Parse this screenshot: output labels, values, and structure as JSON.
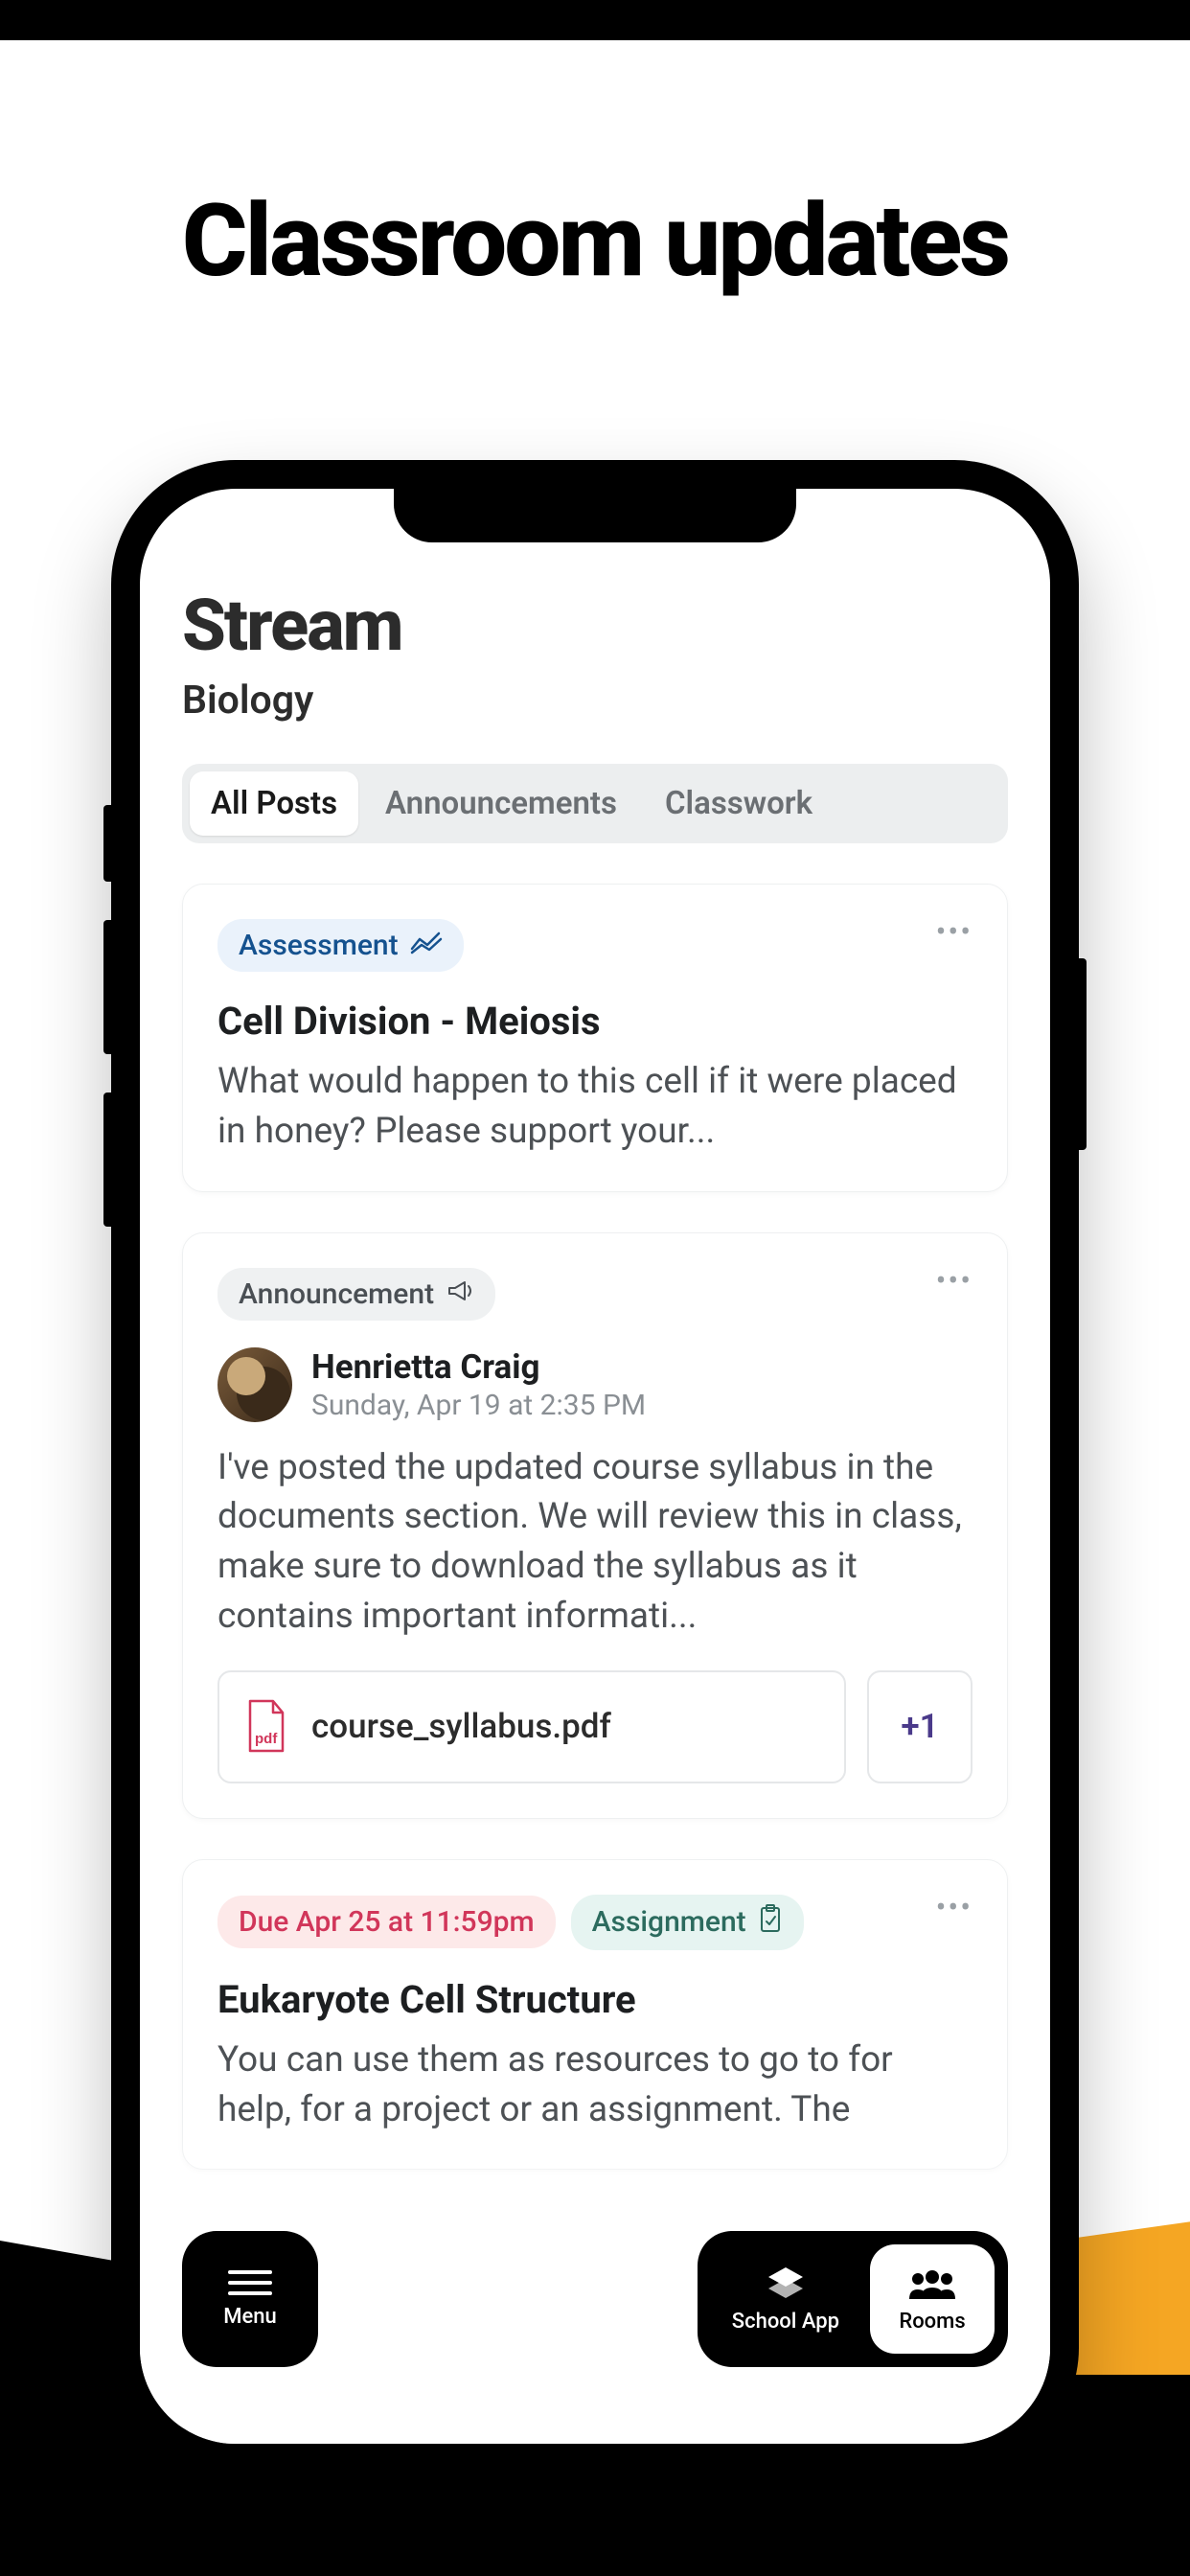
{
  "hero": {
    "title": "Classroom updates"
  },
  "header": {
    "title": "Stream",
    "subtitle": "Biology"
  },
  "tabs": [
    {
      "label": "All Posts",
      "active": true
    },
    {
      "label": "Announcements",
      "active": false
    },
    {
      "label": "Classwork",
      "active": false
    }
  ],
  "posts": [
    {
      "type_label": "Assessment",
      "title": "Cell Division - Meiosis",
      "body": "What would happen to this cell if it were placed in honey? Please support your..."
    },
    {
      "type_label": "Announcement",
      "author": {
        "name": "Henrietta Craig",
        "date": "Sunday, Apr 19 at 2:35 PM"
      },
      "body": "I've posted the updated course syllabus in the documents section. We will review this in class, make sure to download the syllabus as it contains important informati...",
      "attachments": {
        "file": "course_syllabus.pdf",
        "more": "+1"
      }
    },
    {
      "due_label": "Due Apr 25 at 11:59pm",
      "type_label": "Assignment",
      "title": "Eukaryote Cell Structure",
      "body": "You can use them as resources to go to for help, for a project or an assignment. The"
    }
  ],
  "bottom_bar": {
    "menu": "Menu",
    "school_app": "School App",
    "rooms": "Rooms"
  }
}
